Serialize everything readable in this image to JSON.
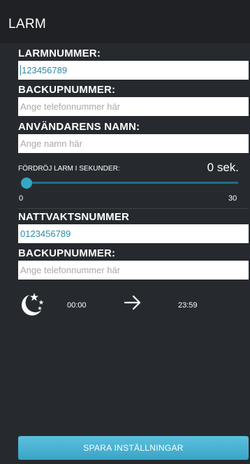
{
  "header": {
    "title": "LARM"
  },
  "alarm_number": {
    "label": "LARMNUMMER:",
    "value": "123456789"
  },
  "backup_number_1": {
    "label": "BACKUPNUMMER:",
    "placeholder": "Ange telefonnummer här"
  },
  "user_name": {
    "label": "ANVÄNDARENS NAMN:",
    "placeholder": "Ange namn här"
  },
  "delay": {
    "label": "FÖRDRÖJ LARM I SEKUNDER:",
    "value_text": "0 sek.",
    "value": 0,
    "min_label": "0",
    "max_label": "30"
  },
  "night_guard_number": {
    "label": "NATTVAKTSNUMMER",
    "value": "0123456789"
  },
  "backup_number_2": {
    "label": "BACKUPNUMMER:",
    "placeholder": "Ange telefonnummer här"
  },
  "night_schedule": {
    "icon": "moon-stars-icon",
    "start": "00:00",
    "arrow_icon": "arrow-right-icon",
    "end": "23:59"
  },
  "save_button": {
    "label": "SPARA INSTÄLLNINGAR"
  },
  "colors": {
    "background": "#262a2f",
    "header": "#1f2125",
    "accent": "#36a6c7",
    "input_text": "#2e8aa6"
  }
}
